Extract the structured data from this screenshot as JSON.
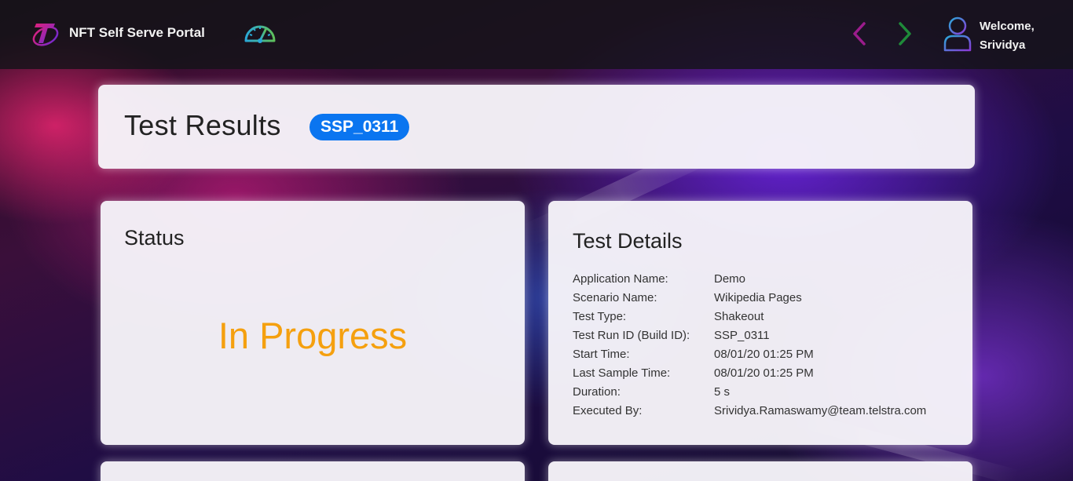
{
  "header": {
    "app_title": "NFT Self Serve Portal",
    "welcome_line1": "Welcome,",
    "welcome_line2": "Srividya",
    "icons": {
      "logo": "telstra-logo",
      "dashboard": "speedometer-icon",
      "back": "chevron-left-icon",
      "forward": "chevron-right-icon",
      "user": "user-icon"
    },
    "colors": {
      "back_arrow": "#9b1c8c",
      "forward_arrow": "#1f8a3a"
    }
  },
  "results": {
    "title": "Test Results",
    "run_id_badge": "SSP_0311",
    "badge_color": "#0a75f0"
  },
  "status": {
    "title": "Status",
    "value": "In Progress",
    "value_color": "#f5a00f"
  },
  "details": {
    "title": "Test Details",
    "rows": [
      {
        "label": "Application Name:",
        "value": "Demo"
      },
      {
        "label": "Scenario Name:",
        "value": "Wikipedia Pages"
      },
      {
        "label": "Test Type:",
        "value": "Shakeout"
      },
      {
        "label": "Test Run ID (Build ID):",
        "value": "SSP_0311"
      },
      {
        "label": "Start Time:",
        "value": "08/01/20 01:25 PM"
      },
      {
        "label": "Last Sample Time:",
        "value": "08/01/20 01:25 PM"
      },
      {
        "label": "Duration:",
        "value": "5 s"
      },
      {
        "label": "Executed By:",
        "value": "Srividya.Ramaswamy@team.telstra.com"
      }
    ]
  }
}
